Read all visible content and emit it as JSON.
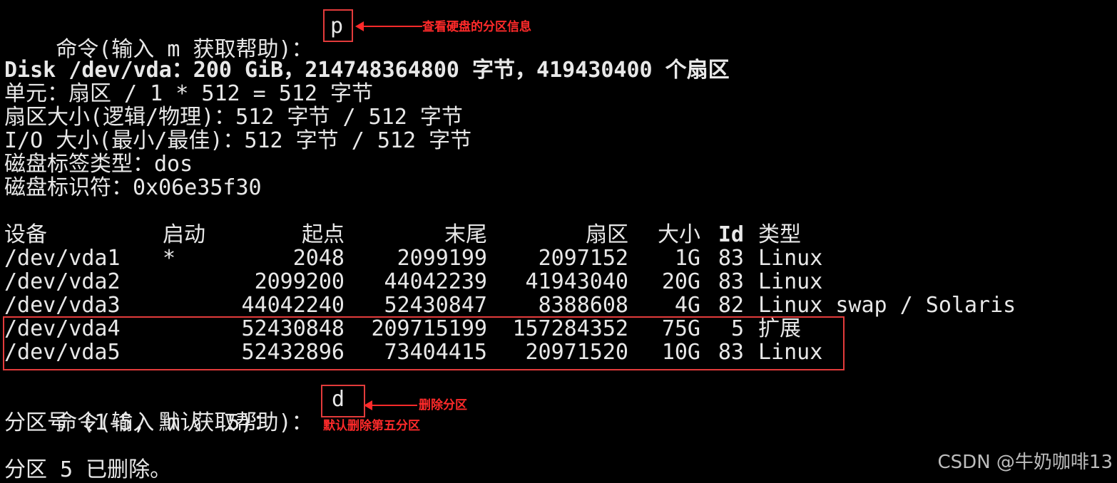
{
  "prompt1": {
    "text": "命令(输入 m 获取帮助)：",
    "input": "p"
  },
  "annotation1": "查看硬盘的分区信息",
  "disk": {
    "line1": "Disk /dev/vda：200 GiB，214748364800 字节，419430400 个扇区",
    "line2": "单元：扇区 / 1 * 512 = 512 字节",
    "line3": "扇区大小(逻辑/物理)：512 字节 / 512 字节",
    "line4": "I/O 大小(最小/最佳)：512 字节 / 512 字节",
    "line5": "磁盘标签类型：dos",
    "line6": "磁盘标识符：0x06e35f30"
  },
  "table": {
    "headers": [
      "设备",
      "启动",
      "起点",
      "末尾",
      "扇区",
      "大小",
      "Id",
      "类型"
    ],
    "rows": [
      [
        "/dev/vda1",
        "*",
        "2048",
        "2099199",
        "2097152",
        "1G",
        "83",
        "Linux"
      ],
      [
        "/dev/vda2",
        "",
        "2099200",
        "44042239",
        "41943040",
        "20G",
        "83",
        "Linux"
      ],
      [
        "/dev/vda3",
        "",
        "44042240",
        "52430847",
        "8388608",
        "4G",
        "82",
        "Linux swap / Solaris"
      ],
      [
        "/dev/vda4",
        "",
        "52430848",
        "209715199",
        "157284352",
        "75G",
        "5",
        "扩展"
      ],
      [
        "/dev/vda5",
        "",
        "52432896",
        "73404415",
        "20971520",
        "10G",
        "83",
        "Linux"
      ]
    ]
  },
  "prompt2": {
    "text": "命令(输入 m 获取帮助)：",
    "input": "d"
  },
  "annotation2": "删除分区",
  "partition_prompt": "分区号 (1-5, 默认  5)：",
  "annotation3": "默认删除第五分区",
  "result": "分区 5 已删除。",
  "watermark": "CSDN @牛奶咖啡13",
  "colors": {
    "background": "#000000",
    "text": "#e8e8e8",
    "annotation": "#ff2a2a",
    "box": "#e33b3b"
  }
}
